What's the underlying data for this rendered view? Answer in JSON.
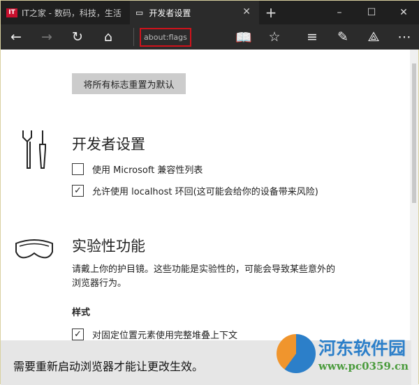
{
  "tabs": [
    {
      "label": "IT之家 - 数码，科技，生活",
      "icon": "it-logo",
      "logo_text": "IT"
    },
    {
      "label": "开发者设置",
      "icon": "page-icon",
      "active": true
    }
  ],
  "window": {
    "new_tab": "+",
    "minimize": "–",
    "maximize": "☐",
    "close": "✕",
    "tab_close": "✕"
  },
  "toolbar": {
    "address": "about:flags"
  },
  "content": {
    "reset_button": "将所有标志重置为默认",
    "developer": {
      "title": "开发者设置",
      "options": [
        {
          "label": "使用 Microsoft 兼容性列表",
          "checked": false
        },
        {
          "label": "允许使用 localhost 环回(这可能会给你的设备带来风险)",
          "checked": true
        }
      ]
    },
    "experimental": {
      "title": "实验性功能",
      "description": "请戴上你的护目镜。这些功能是实验性的，可能会导致某些意外的浏览器行为。",
      "section": "样式",
      "options": [
        {
          "label": "对固定位置元素使用完整堆叠上下文",
          "checked": true
        }
      ]
    }
  },
  "notice": "需要重新启动浏览器才能让更改生效。",
  "watermark": {
    "name": "河东软件园",
    "url": "www.pc0359.cn"
  },
  "colors": {
    "chrome": "#2b2b2b",
    "highlight": "#d0121b",
    "notice_bg": "#e6e6e6"
  }
}
